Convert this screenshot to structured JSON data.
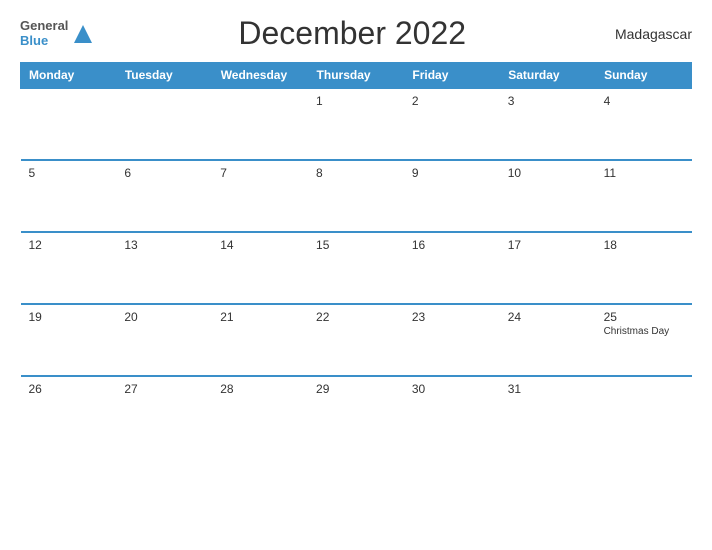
{
  "header": {
    "logo_general": "General",
    "logo_blue": "Blue",
    "title": "December 2022",
    "country": "Madagascar"
  },
  "calendar": {
    "days": [
      "Monday",
      "Tuesday",
      "Wednesday",
      "Thursday",
      "Friday",
      "Saturday",
      "Sunday"
    ],
    "weeks": [
      [
        {
          "date": "",
          "holiday": "",
          "empty": true
        },
        {
          "date": "",
          "holiday": "",
          "empty": true
        },
        {
          "date": "",
          "holiday": "",
          "empty": true
        },
        {
          "date": "1",
          "holiday": ""
        },
        {
          "date": "2",
          "holiday": ""
        },
        {
          "date": "3",
          "holiday": ""
        },
        {
          "date": "4",
          "holiday": ""
        }
      ],
      [
        {
          "date": "5",
          "holiday": ""
        },
        {
          "date": "6",
          "holiday": ""
        },
        {
          "date": "7",
          "holiday": ""
        },
        {
          "date": "8",
          "holiday": ""
        },
        {
          "date": "9",
          "holiday": ""
        },
        {
          "date": "10",
          "holiday": ""
        },
        {
          "date": "11",
          "holiday": ""
        }
      ],
      [
        {
          "date": "12",
          "holiday": ""
        },
        {
          "date": "13",
          "holiday": ""
        },
        {
          "date": "14",
          "holiday": ""
        },
        {
          "date": "15",
          "holiday": ""
        },
        {
          "date": "16",
          "holiday": ""
        },
        {
          "date": "17",
          "holiday": ""
        },
        {
          "date": "18",
          "holiday": ""
        }
      ],
      [
        {
          "date": "19",
          "holiday": ""
        },
        {
          "date": "20",
          "holiday": ""
        },
        {
          "date": "21",
          "holiday": ""
        },
        {
          "date": "22",
          "holiday": ""
        },
        {
          "date": "23",
          "holiday": ""
        },
        {
          "date": "24",
          "holiday": ""
        },
        {
          "date": "25",
          "holiday": "Christmas Day"
        }
      ],
      [
        {
          "date": "26",
          "holiday": ""
        },
        {
          "date": "27",
          "holiday": ""
        },
        {
          "date": "28",
          "holiday": ""
        },
        {
          "date": "29",
          "holiday": ""
        },
        {
          "date": "30",
          "holiday": ""
        },
        {
          "date": "31",
          "holiday": ""
        },
        {
          "date": "",
          "holiday": "",
          "empty": true
        }
      ]
    ]
  }
}
